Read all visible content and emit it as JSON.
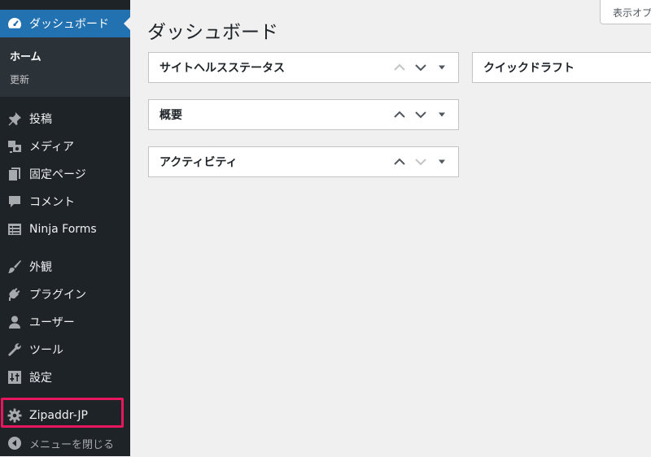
{
  "sidebar": {
    "dashboard_label": "ダッシュボード",
    "submenu": {
      "home": "ホーム",
      "updates": "更新"
    },
    "items": [
      {
        "key": "posts",
        "label": "投稿",
        "icon": "pin-icon"
      },
      {
        "key": "media",
        "label": "メディア",
        "icon": "media-icon"
      },
      {
        "key": "pages",
        "label": "固定ページ",
        "icon": "pages-icon"
      },
      {
        "key": "comments",
        "label": "コメント",
        "icon": "comment-icon"
      },
      {
        "key": "ninja-forms",
        "label": "Ninja Forms",
        "icon": "forms-icon"
      },
      {
        "key": "appearance",
        "label": "外観",
        "icon": "brush-icon"
      },
      {
        "key": "plugins",
        "label": "プラグイン",
        "icon": "plug-icon"
      },
      {
        "key": "users",
        "label": "ユーザー",
        "icon": "user-icon"
      },
      {
        "key": "tools",
        "label": "ツール",
        "icon": "wrench-icon"
      },
      {
        "key": "settings",
        "label": "設定",
        "icon": "sliders-icon"
      },
      {
        "key": "zipaddr",
        "label": "Zipaddr-JP",
        "icon": "gear-icon"
      }
    ],
    "collapse_label": "メニューを閉じる"
  },
  "header": {
    "screen_options": "表示オプション",
    "page_title": "ダッシュボード"
  },
  "widgets": {
    "site_health": "サイトヘルスステータス",
    "overview": "概要",
    "activity": "アクティビティ",
    "quick_draft": "クイックドラフト"
  },
  "colors": {
    "sidebar_bg": "#1d2327",
    "submenu_bg": "#2c3338",
    "accent": "#2271b1",
    "highlight": "#e8175d",
    "page_bg": "#f0f0f1"
  }
}
